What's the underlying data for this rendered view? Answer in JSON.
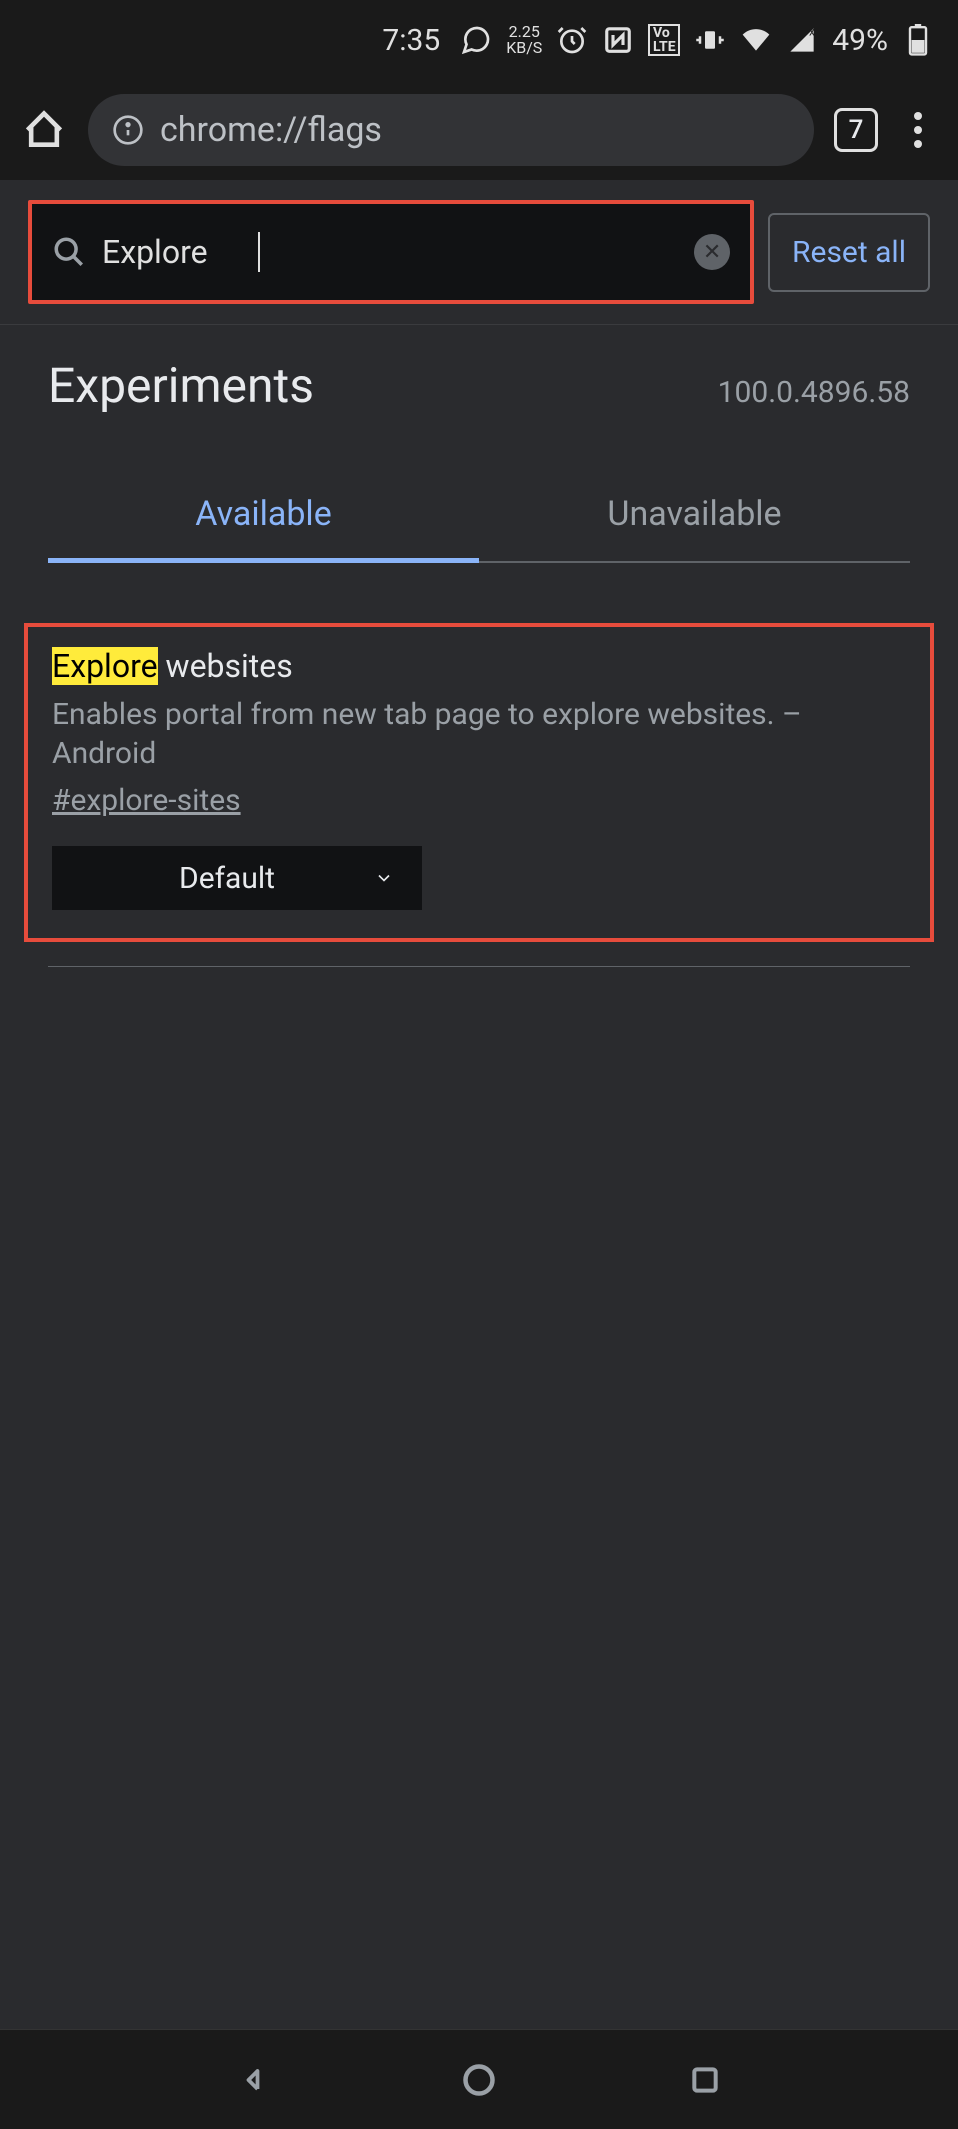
{
  "status_bar": {
    "time": "7:35",
    "kbs_top": "2.25",
    "kbs_bottom": "KB/S",
    "battery_pct": "49%"
  },
  "browser": {
    "url": "chrome://flags",
    "tab_count": "7"
  },
  "search": {
    "value": "Explore",
    "reset_label": "Reset all"
  },
  "header": {
    "title": "Experiments",
    "version": "100.0.4896.58"
  },
  "tabs": {
    "available": "Available",
    "unavailable": "Unavailable"
  },
  "flag": {
    "title_highlight": "Explore",
    "title_rest": " websites",
    "description": "Enables portal from new tab page to explore websites. – Android",
    "tag": "#explore-sites",
    "dropdown_value": "Default"
  }
}
